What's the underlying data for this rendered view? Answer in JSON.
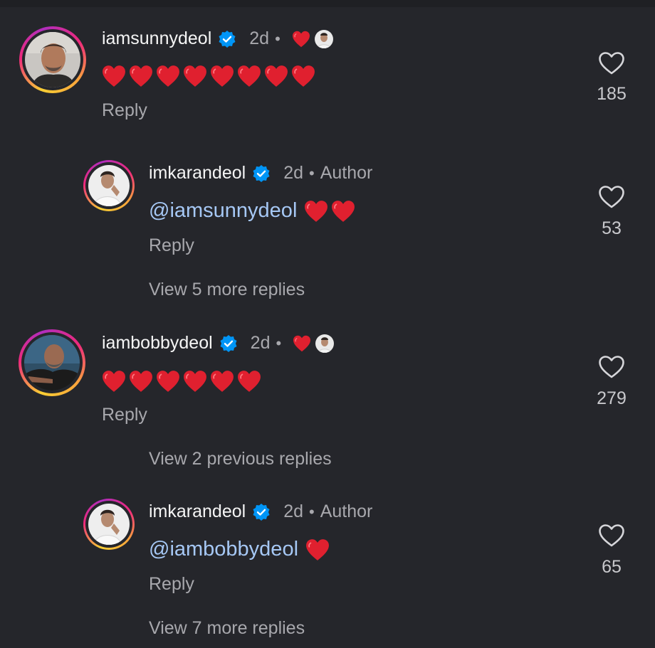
{
  "comments": [
    {
      "username": "iamsunnydeol",
      "time": "2d",
      "dot": "•",
      "text_hearts": 8,
      "reply_label": "Reply",
      "like_count": "185"
    },
    {
      "username": "imkarandeol",
      "time": "2d",
      "dot": "•",
      "author_label": "Author",
      "mention": "@iamsunnydeol",
      "text_hearts": 2,
      "reply_label": "Reply",
      "like_count": "53",
      "view_more": "View 5 more replies"
    },
    {
      "username": "iambobbydeol",
      "time": "2d",
      "dot": "•",
      "text_hearts": 6,
      "reply_label": "Reply",
      "like_count": "279",
      "view_previous": "View 2 previous replies"
    },
    {
      "username": "imkarandeol",
      "time": "2d",
      "dot": "•",
      "author_label": "Author",
      "mention": "@iambobbydeol",
      "text_hearts": 1,
      "reply_label": "Reply",
      "like_count": "65",
      "view_more": "View 7 more replies"
    }
  ],
  "icons": {
    "verified": "verified-badge-icon",
    "like": "heart-outline-icon",
    "liked_by_author": "red-heart-icon"
  },
  "colors": {
    "background": "#25262b",
    "verified": "#0095f6",
    "heart": "#e0202f",
    "mention": "#a6c8f5",
    "muted": "#a8a8ad"
  }
}
